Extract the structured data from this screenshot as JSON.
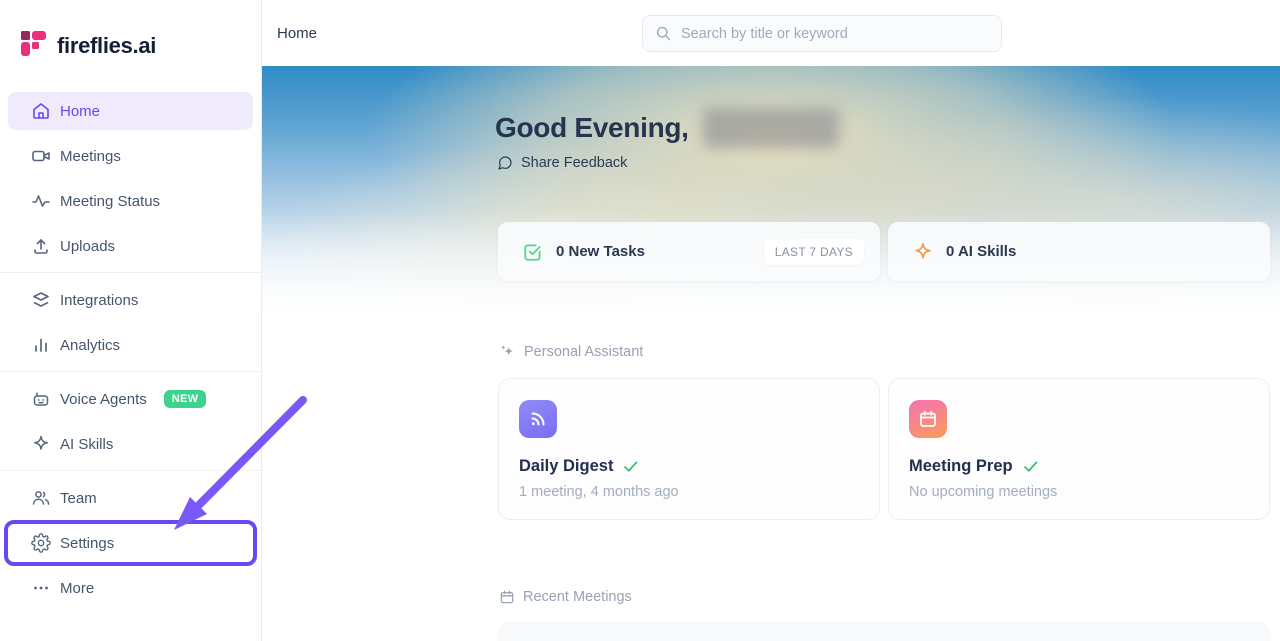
{
  "sidebar": {
    "logo_text": "fireflies.ai",
    "items": [
      {
        "label": "Home",
        "active": true
      },
      {
        "label": "Meetings"
      },
      {
        "label": "Meeting Status"
      },
      {
        "label": "Uploads"
      },
      {
        "label": "Integrations"
      },
      {
        "label": "Analytics"
      },
      {
        "label": "Voice Agents",
        "badge": "NEW"
      },
      {
        "label": "AI Skills"
      },
      {
        "label": "Team"
      },
      {
        "label": "Settings",
        "highlighted": true
      },
      {
        "label": "More"
      }
    ]
  },
  "topbar": {
    "breadcrumb": "Home",
    "search_placeholder": "Search by title or keyword"
  },
  "hero": {
    "greeting": "Good Evening,",
    "share_feedback": "Share Feedback"
  },
  "stats": [
    {
      "label": "0 New Tasks",
      "badge": "LAST 7 DAYS",
      "icon": "task-check-icon"
    },
    {
      "label": "0 AI Skills",
      "icon": "sparkle-icon"
    }
  ],
  "personal_assistant": {
    "title": "Personal Assistant",
    "cards": [
      {
        "title": "Daily Digest",
        "subtitle": "1 meeting, 4 months ago",
        "icon": "rss-icon",
        "status": "done"
      },
      {
        "title": "Meeting Prep",
        "subtitle": "No upcoming meetings",
        "icon": "calendar-icon",
        "status": "done"
      }
    ]
  },
  "recent_meetings": {
    "title": "Recent Meetings"
  },
  "colors": {
    "accent_purple": "#6b46f2",
    "brand_pink": "#e92f7d",
    "badge_green": "#3ed38c",
    "check_green": "#2fbf71",
    "annotation_purple": "#7a58f6",
    "skill_orange": "#f19d4f"
  }
}
